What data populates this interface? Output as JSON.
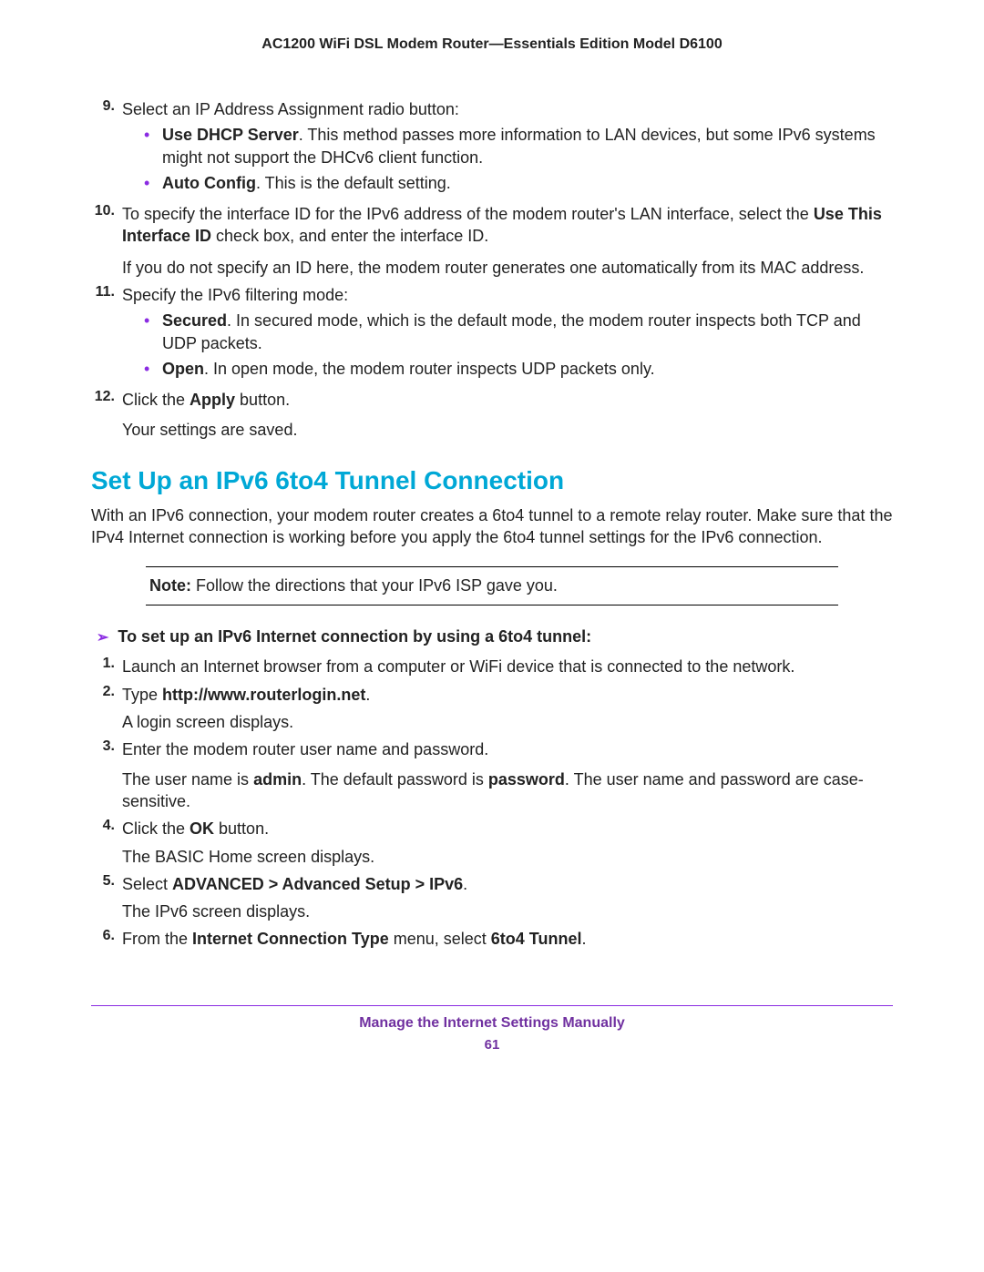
{
  "header": "AC1200 WiFi DSL Modem Router—Essentials Edition Model D6100",
  "s9": {
    "num": "9.",
    "lead": "Select an IP Address Assignment radio button:",
    "b1_bold": "Use DHCP Server",
    "b1_rest": ". This method passes more information to LAN devices, but some IPv6 systems might not support the DHCv6 client function.",
    "b2_bold": "Auto Config",
    "b2_rest": ". This is the default setting."
  },
  "s10": {
    "num": "10.",
    "p1a": "To specify the interface ID for the IPv6 address of the modem router's LAN interface, select the ",
    "p1b": "Use This Interface ID",
    "p1c": " check box, and enter the interface ID.",
    "p2": "If you do not specify an ID here, the modem router generates one automatically from its MAC address."
  },
  "s11": {
    "num": "11.",
    "lead": "Specify the IPv6 filtering mode:",
    "b1_bold": "Secured",
    "b1_rest": ". In secured mode, which is the default mode, the modem router inspects both TCP and UDP packets.",
    "b2_bold": "Open",
    "b2_rest": ". In open mode, the modem router inspects UDP packets only."
  },
  "s12": {
    "num": "12.",
    "p1a": "Click the ",
    "p1b": "Apply",
    "p1c": " button.",
    "p2": "Your settings are saved."
  },
  "h2": "Set Up an IPv6 6to4 Tunnel Connection",
  "intro": "With an IPv6 connection, your modem router creates a 6to4 tunnel to a remote relay router. Make sure that the IPv4 Internet connection is working before you apply the 6to4 tunnel settings for the IPv6 connection.",
  "note_label": "Note:",
  "note_text": " Follow the directions that your IPv6 ISP gave you.",
  "proc_lead": "To set up an IPv6 Internet connection by using a 6to4 tunnel:",
  "t1": {
    "num": "1.",
    "text": "Launch an Internet browser from a computer or WiFi device that is connected to the network."
  },
  "t2": {
    "num": "2.",
    "a": "Type ",
    "b": "http://www.routerlogin.net",
    "c": ".",
    "p2": "A login screen displays."
  },
  "t3": {
    "num": "3.",
    "p1": "Enter the modem router user name and password.",
    "p2a": "The user name is ",
    "p2b": "admin",
    "p2c": ". The default password is ",
    "p2d": "password",
    "p2e": ". The user name and password are case-sensitive."
  },
  "t4": {
    "num": "4.",
    "a": "Click the ",
    "b": "OK",
    "c": " button.",
    "p2": "The BASIC Home screen displays."
  },
  "t5": {
    "num": "5.",
    "a": "Select ",
    "b": "ADVANCED > Advanced Setup > IPv6",
    "c": ".",
    "p2": "The IPv6 screen displays."
  },
  "t6": {
    "num": "6.",
    "a": "From the ",
    "b": "Internet Connection Type",
    "c": " menu, select ",
    "d": "6to4 Tunnel",
    "e": "."
  },
  "footer_title": "Manage the Internet Settings Manually",
  "page_num": "61"
}
